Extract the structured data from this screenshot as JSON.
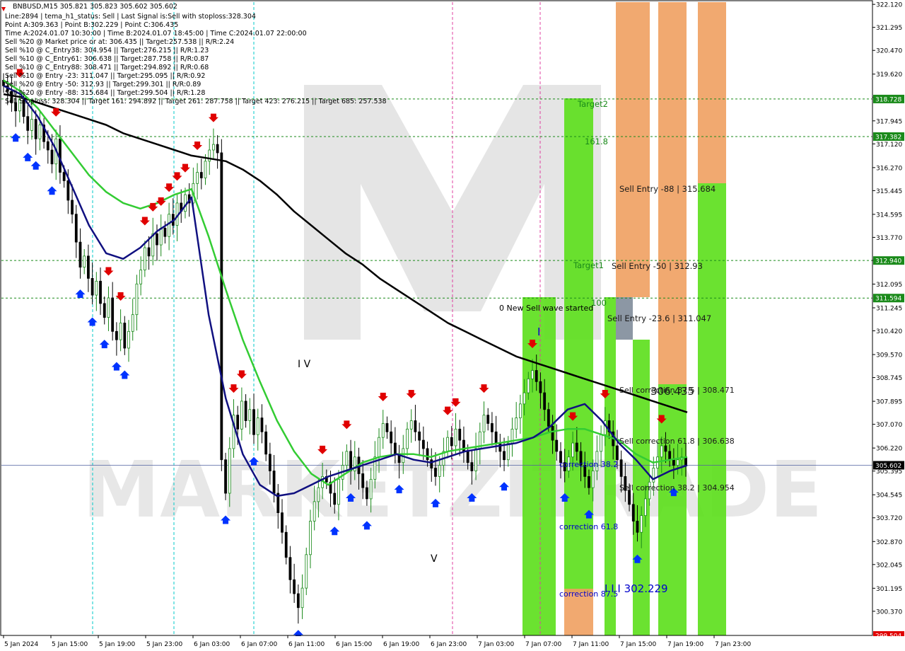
{
  "header": {
    "symbol_line": "BNBUSD,M15  305.821 305.823 305.602 305.602",
    "info_lines": [
      "Line:2894 | tema_h1_status: Sell | Last Signal is:Sell with stoploss:328.304",
      "Point A:309.363 | Point B:302.229 | Point C:306.435",
      "Time A:2024.01.07 10:30:00 | Time B:2024.01.07 18:45:00 | Time C:2024.01.07 22:00:00",
      "Sell %20 @ Market price or at: 306.435 || Target:257.538 || R/R:2.24",
      "Sell %10 @ C_Entry38: 304.954 || Target:276.215 || R/R:1.23",
      "Sell %10 @ C_Entry61: 306.638 || Target:287.758 || R/R:0.87",
      "Sell %10 @ C_Entry88: 308.471 || Target:294.892 || R/R:0.68",
      "Sell %10 @ Entry -23: 311.047 || Target:295.095 || R/R:0.92",
      "Sell %20 @ Entry -50: 312.93 || Target:299.301 || R/R:0.89",
      "Sell %20 @ Entry -88: 315.684 || Target:299.504 || R/R:1.28",
      "Sell Stoploss: 328.304 || Target 161: 294.892 || Target 261: 287.758 || Target 423: 276.215 || Target 685: 257.538"
    ]
  },
  "watermark": "MARKETZITRADE",
  "colors": {
    "bg": "#ffffff",
    "bull": "#1a8a1a",
    "bear": "#000000",
    "ma_black": "#000000",
    "ma_green": "#33cc33",
    "ma_navy": "#101080",
    "zone_green": "#5ee01e",
    "zone_orange": "#f0a060",
    "zone_gray": "#7f8c9a",
    "hline": "#1a8a1a",
    "vline_cyan": "#00c8c8",
    "vline_magenta": "#e040a0",
    "bid_line": "#5060a0",
    "sell_arrow": "#e00000",
    "buy_arrow": "#0033ff"
  },
  "chart_data": {
    "type": "candlestick",
    "symbol": "BNBUSD",
    "timeframe": "M15",
    "ylim": [
      299.504,
      322.2
    ],
    "price_ticks": [
      322.12,
      321.295,
      320.47,
      319.62,
      318.795,
      317.945,
      317.12,
      316.27,
      315.445,
      314.595,
      313.77,
      312.945,
      312.095,
      311.245,
      310.42,
      309.57,
      308.745,
      307.895,
      307.07,
      306.22,
      305.395,
      304.545,
      303.72,
      302.87,
      302.045,
      301.195,
      300.37
    ],
    "highlighted_prices": [
      {
        "value": 318.728,
        "label": "318.728",
        "style": "green"
      },
      {
        "value": 317.382,
        "label": "317.382",
        "style": "green"
      },
      {
        "value": 312.94,
        "label": "312.940",
        "style": "green"
      },
      {
        "value": 311.594,
        "label": "311.594",
        "style": "green"
      },
      {
        "value": 305.602,
        "label": "305.602",
        "style": "current"
      },
      {
        "value": 299.504,
        "label": "299.504",
        "style": "red"
      }
    ],
    "time_labels": [
      "5 Jan 2024",
      "5 Jan 15:00",
      "5 Jan 19:00",
      "5 Jan 23:00",
      "6 Jan 03:00",
      "6 Jan 07:00",
      "6 Jan 11:00",
      "6 Jan 15:00",
      "6 Jan 19:00",
      "6 Jan 23:00",
      "7 Jan 03:00",
      "7 Jan 07:00",
      "7 Jan 11:00",
      "7 Jan 15:00",
      "7 Jan 19:00",
      "7 Jan 23:00"
    ],
    "closes": [
      319.2,
      319.0,
      318.6,
      318.3,
      318.7,
      318.1,
      317.6,
      318.0,
      317.3,
      317.8,
      317.2,
      316.9,
      316.4,
      317.3,
      316.1,
      315.8,
      315.1,
      314.6,
      313.6,
      312.7,
      313.1,
      312.3,
      311.7,
      312.2,
      311.4,
      310.9,
      311.6,
      310.4,
      310.1,
      310.7,
      309.8,
      310.4,
      311.0,
      312.1,
      312.6,
      313.4,
      313.1,
      313.9,
      313.5,
      314.1,
      313.8,
      314.6,
      314.2,
      315.0,
      314.7,
      315.3,
      315.0,
      315.7,
      316.1,
      315.9,
      316.5,
      316.9,
      317.1,
      316.8,
      305.8,
      304.6,
      306.2,
      307.4,
      306.9,
      307.9,
      307.2,
      307.6,
      306.7,
      307.3,
      306.8,
      306.0,
      305.4,
      304.6,
      303.9,
      303.2,
      302.3,
      301.5,
      301.0,
      300.5,
      301.2,
      302.4,
      303.6,
      304.3,
      304.8,
      305.2,
      305.0,
      304.6,
      304.2,
      305.1,
      305.6,
      306.1,
      305.4,
      305.9,
      305.3,
      304.8,
      304.4,
      305.1,
      305.9,
      306.6,
      307.1,
      306.8,
      306.4,
      306.0,
      305.7,
      306.2,
      306.9,
      307.2,
      306.8,
      306.5,
      306.2,
      305.8,
      305.5,
      305.2,
      305.6,
      306.1,
      306.6,
      306.3,
      306.9,
      306.5,
      306.1,
      305.7,
      305.4,
      306.2,
      306.8,
      307.4,
      307.1,
      306.8,
      306.4,
      306.1,
      305.8,
      306.4,
      306.9,
      307.3,
      307.8,
      308.2,
      308.7,
      309.0,
      308.6,
      308.2,
      307.6,
      307.0,
      306.5,
      306.1,
      305.7,
      305.4,
      305.9,
      306.4,
      306.1,
      305.6,
      305.2,
      304.8,
      305.4,
      306.1,
      306.7,
      307.2,
      306.8,
      306.3,
      305.8,
      305.2,
      304.7,
      304.2,
      303.6,
      303.2,
      303.8,
      304.4,
      305.0,
      305.5,
      305.9,
      306.3,
      306.1,
      305.8,
      305.6,
      305.8,
      305.9,
      305.6
    ],
    "moving_averages": [
      {
        "name": "black",
        "values": [
          318.9,
          318.8,
          318.6,
          318.4,
          318.2,
          318.0,
          317.8,
          317.5,
          317.3,
          317.1,
          316.9,
          316.7,
          316.6,
          316.5,
          316.2,
          315.8,
          315.3,
          314.7,
          314.2,
          313.7,
          313.2,
          312.8,
          312.3,
          311.9,
          311.5,
          311.1,
          310.7,
          310.4,
          310.1,
          309.8,
          309.5,
          309.3,
          309.1,
          308.9,
          308.7,
          308.5,
          308.3,
          308.1,
          307.9,
          307.7,
          307.5
        ]
      },
      {
        "name": "green",
        "values": [
          319.4,
          319.0,
          318.4,
          317.6,
          316.8,
          316.0,
          315.4,
          315.0,
          314.8,
          315.0,
          315.3,
          315.5,
          313.8,
          311.9,
          310.1,
          308.6,
          307.2,
          306.1,
          305.3,
          304.9,
          305.3,
          305.7,
          305.9,
          306.0,
          306.0,
          305.9,
          306.1,
          306.2,
          306.3,
          306.4,
          306.5,
          306.6,
          306.8,
          306.9,
          306.9,
          306.7,
          306.5,
          306.0,
          305.7,
          305.8,
          305.9
        ]
      },
      {
        "name": "navy",
        "values": [
          319.2,
          318.9,
          318.1,
          317.0,
          315.6,
          314.2,
          313.2,
          313.0,
          313.4,
          314.0,
          314.4,
          315.2,
          311.0,
          308.0,
          306.0,
          304.9,
          304.5,
          304.6,
          304.9,
          305.2,
          305.4,
          305.6,
          305.8,
          306.0,
          305.8,
          305.7,
          305.9,
          306.1,
          306.2,
          306.3,
          306.4,
          306.6,
          307.0,
          307.6,
          307.8,
          307.2,
          306.4,
          305.8,
          305.1,
          305.4,
          305.6
        ]
      }
    ],
    "zones": [
      {
        "name": "correction-zone-1",
        "color": "green"
      },
      {
        "name": "target-zone",
        "color": "green"
      },
      {
        "name": "target-zone-orange",
        "color": "orange"
      },
      {
        "name": "entry-zone-green",
        "color": "green"
      },
      {
        "name": "entry-zone-orange",
        "color": "orange"
      },
      {
        "name": "right-zone-green",
        "color": "green"
      },
      {
        "name": "right-zone-orange",
        "color": "orange"
      }
    ],
    "annotations": [
      {
        "key": "target2",
        "text": "Target2"
      },
      {
        "key": "fib161",
        "text": "161.8"
      },
      {
        "key": "sell_entry_88",
        "text": "Sell Entry -88 | 315.684"
      },
      {
        "key": "target1",
        "text": "Target1"
      },
      {
        "key": "sell_entry_50",
        "text": "Sell Entry -50 | 312.93"
      },
      {
        "key": "fib100",
        "text": "100"
      },
      {
        "key": "new_wave",
        "text": "0 New Sell wave started"
      },
      {
        "key": "sell_entry_23",
        "text": "Sell Entry -23.6 | 311.047"
      },
      {
        "key": "sell_correction_87",
        "text": "Sell correction 87.5 | 308.471"
      },
      {
        "key": "point_c",
        "text": "306.435"
      },
      {
        "key": "sell_correction_61",
        "text": "Sell correction 61.8 | 306.638"
      },
      {
        "key": "correction38_left",
        "text": "correction 38.2"
      },
      {
        "key": "sell_correction_38",
        "text": "Sell correction 38.2 | 304.954"
      },
      {
        "key": "correction61",
        "text": "correction 61.8"
      },
      {
        "key": "correction87",
        "text": "correction 87.5"
      },
      {
        "key": "point_b",
        "text": "I I I 302.229"
      },
      {
        "key": "wave_iv",
        "text": "I V"
      },
      {
        "key": "wave_v",
        "text": "V"
      },
      {
        "key": "wave_i",
        "text": "I"
      }
    ]
  }
}
